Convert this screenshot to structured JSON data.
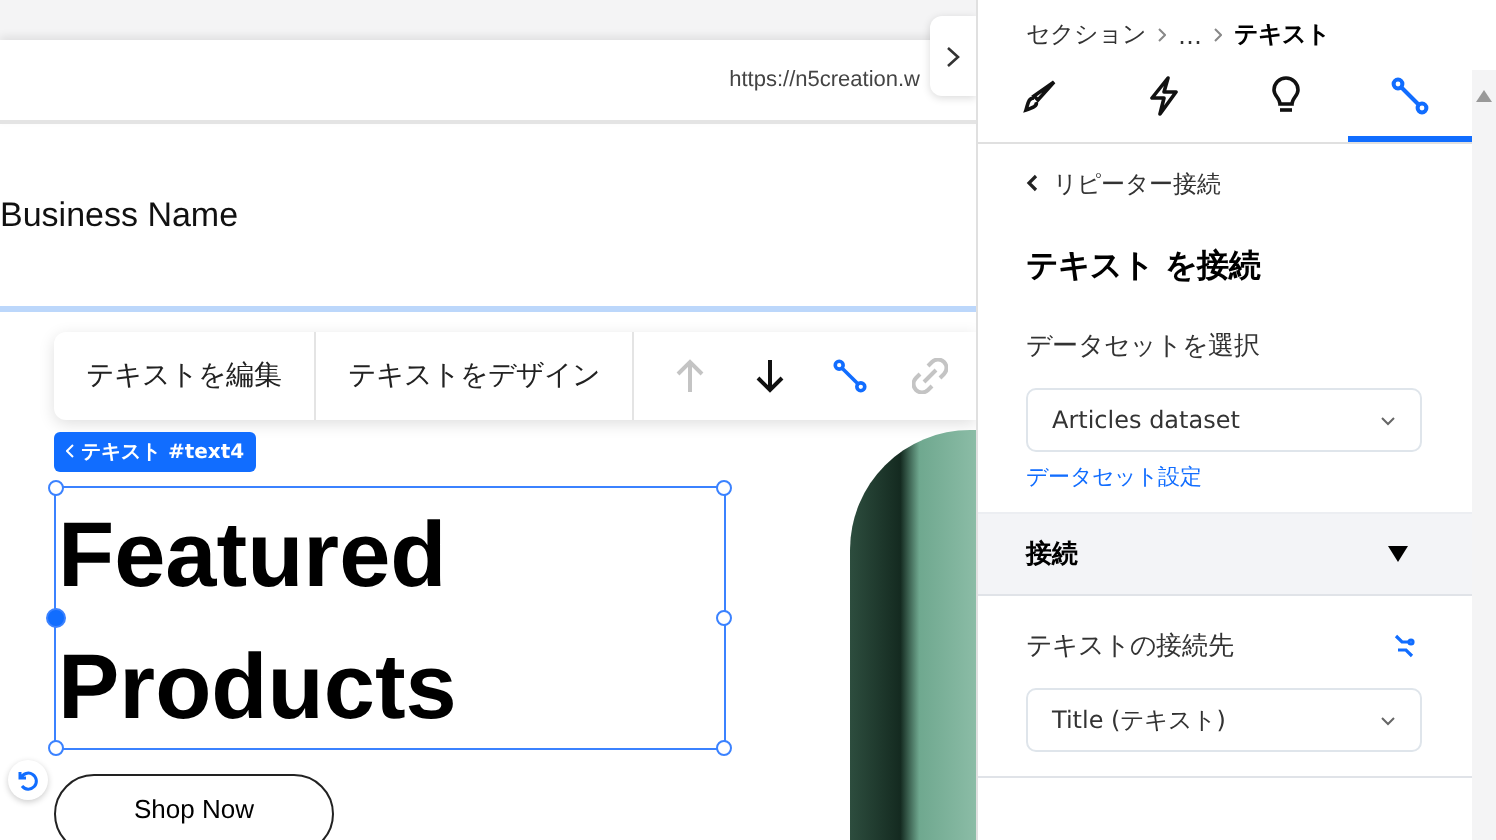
{
  "preview": {
    "url": "https://n5creation.w",
    "business_name": "Business Name"
  },
  "toolbar": {
    "buttons": [
      "テキストを編集",
      "テキストをデザイン"
    ],
    "icons": [
      {
        "kind": "up",
        "disabled": true
      },
      {
        "kind": "down",
        "disabled": false
      },
      {
        "kind": "connect",
        "disabled": false,
        "selected": true
      },
      {
        "kind": "link",
        "disabled": true
      }
    ]
  },
  "element_tag": "テキスト #text4",
  "headline": [
    "Featured",
    "Products"
  ],
  "cta_button": "Shop Now",
  "panel": {
    "breadcrumb": [
      "セクション",
      "…",
      "テキスト"
    ],
    "tabs": [
      {
        "kind": "design",
        "selected": false
      },
      {
        "kind": "interactions",
        "selected": false
      },
      {
        "kind": "tips",
        "selected": false
      },
      {
        "kind": "connect",
        "selected": true
      }
    ],
    "back_link": "リピーター接続",
    "heading": "テキスト を接続",
    "dataset_label": "データセットを選択",
    "dataset_value": "Articles dataset",
    "dataset_settings_link": "データセット設定",
    "section_title": "接続",
    "section_expanded": true,
    "target_label": "テキストの接続先",
    "target_value": "Title (テキスト)"
  }
}
